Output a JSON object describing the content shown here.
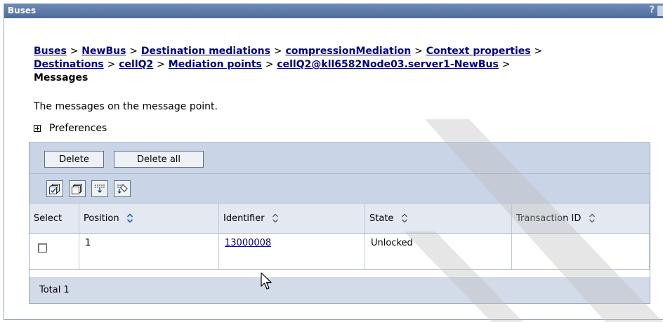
{
  "window": {
    "title": "Buses",
    "help_label": "?"
  },
  "breadcrumb": {
    "items": [
      "Buses",
      "NewBus",
      "Destination mediations",
      "compressionMediation",
      "Context properties",
      "Destinations",
      "cellQ2",
      "Mediation points",
      "cellQ2@kll6582Node03.server1-NewBus"
    ],
    "separator": ">",
    "current": "Messages"
  },
  "description": "The messages on the message point.",
  "preferences": {
    "label": "Preferences"
  },
  "toolbar": {
    "delete_label": "Delete",
    "delete_all_label": "Delete all"
  },
  "icons": [
    "select-all-icon",
    "deselect-all-icon",
    "show-filter-icon",
    "clear-filter-icon"
  ],
  "table": {
    "columns": [
      "Select",
      "Position",
      "Identifier",
      "State",
      "Transaction ID"
    ],
    "rows": [
      {
        "position": "1",
        "identifier": "13000008",
        "state": "Unlocked",
        "transaction_id": ""
      }
    ],
    "total_label": "Total 1"
  },
  "colors": {
    "title_bar": "#5b78a6",
    "link": "#000080",
    "panel_bg": "#c9d4e6",
    "sort_active": "#1560c6"
  }
}
